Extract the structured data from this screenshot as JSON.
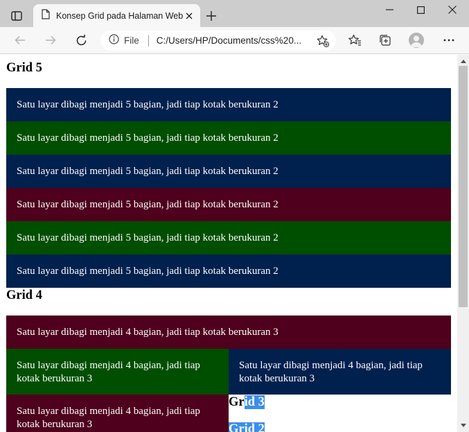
{
  "browser": {
    "tab": {
      "title": "Konsep Grid pada Halaman Web"
    },
    "address": {
      "scheme_label": "File",
      "url": "C:/Users/HP/Documents/css%20..."
    },
    "icons": {
      "tab_actions": "tab-actions-icon",
      "page": "page-icon",
      "close": "close-icon",
      "new_tab": "plus-icon",
      "back": "arrow-left-icon",
      "forward": "arrow-right-icon",
      "refresh": "refresh-icon",
      "info": "info-icon",
      "favorite_add": "star-plus-icon",
      "favorites": "favorites-icon",
      "collections": "collections-icon",
      "profile": "profile-icon",
      "more": "more-icon"
    }
  },
  "page": {
    "sections": {
      "grid5": {
        "heading": "Grid 5",
        "boxes": [
          "Satu layar dibagi menjadi 5 bagian, jadi tiap kotak berukuran 2",
          "Satu layar dibagi menjadi 5 bagian, jadi tiap kotak berukuran 2",
          "Satu layar dibagi menjadi 5 bagian, jadi tiap kotak berukuran 2",
          "Satu layar dibagi menjadi 5 bagian, jadi tiap kotak berukuran 2",
          "Satu layar dibagi menjadi 5 bagian, jadi tiap kotak berukuran 2",
          "Satu layar dibagi menjadi 5 bagian, jadi tiap kotak berukuran 2"
        ]
      },
      "grid4": {
        "heading": "Grid 4",
        "boxes": [
          "Satu layar dibagi menjadi 4 bagian, jadi tiap kotak berukuran 3",
          "Satu layar dibagi menjadi 4 bagian, jadi tiap kotak berukuran 3",
          "Satu layar dibagi menjadi 4 bagian, jadi tiap kotak berukuran 3",
          "Satu layar dibagi menjadi 4 bagian, jadi tiap kotak berukuran 3"
        ]
      },
      "grid3": {
        "heading_plain": "Gr",
        "heading_selected": "id 3"
      },
      "grid2": {
        "heading_selected": "Grid 2"
      }
    },
    "colors": {
      "navy": "#00204e",
      "green": "#004e00",
      "maroon": "#4e001c",
      "selection": "#3d8ee8"
    }
  }
}
